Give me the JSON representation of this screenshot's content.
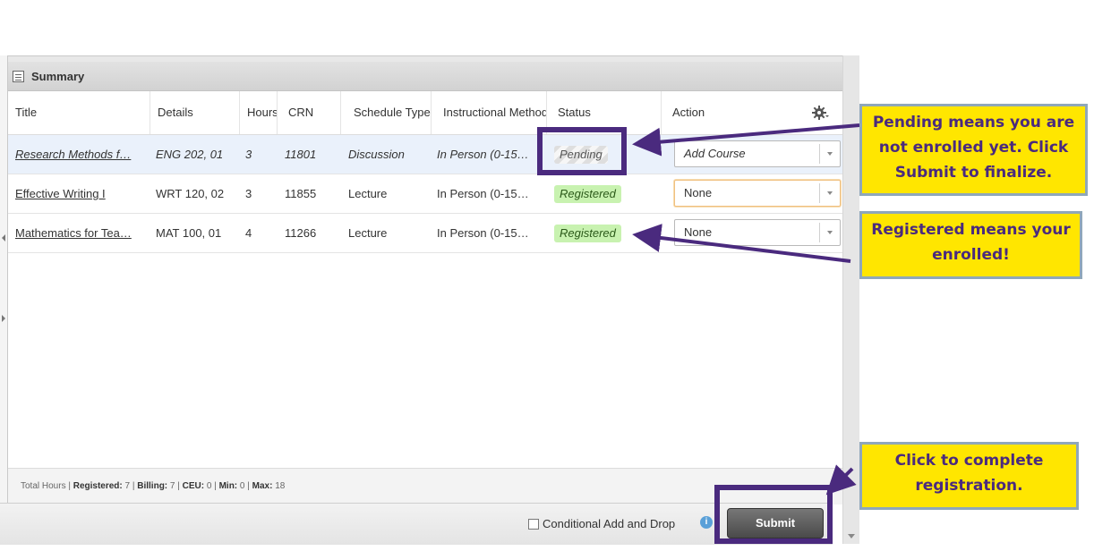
{
  "panel": {
    "title": "Summary"
  },
  "columns": [
    "Title",
    "Details",
    "Hours",
    "CRN",
    "Schedule Type",
    "Instructional Method",
    "Status",
    "Action"
  ],
  "rows": [
    {
      "title": "Research Methods f…",
      "details": "ENG 202, 01",
      "hours": "3",
      "crn": "11801",
      "schedule": "Discussion",
      "method": "In Person (0-15…",
      "status": "Pending",
      "action": "Add Course"
    },
    {
      "title": "Effective Writing I",
      "details": "WRT 120, 02",
      "hours": "3",
      "crn": "11855",
      "schedule": "Lecture",
      "method": "In Person (0-15…",
      "status": "Registered",
      "action": "None"
    },
    {
      "title": "Mathematics for Tea…",
      "details": "MAT 100, 01",
      "hours": "4",
      "crn": "11266",
      "schedule": "Lecture",
      "method": "In Person (0-15…",
      "status": "Registered",
      "action": "None"
    }
  ],
  "totals": {
    "label": "Total Hours",
    "registered_label": "Registered:",
    "registered": "7",
    "billing_label": "Billing:",
    "billing": "7",
    "ceu_label": "CEU:",
    "ceu": "0",
    "min_label": "Min:",
    "min": "0",
    "max_label": "Max:",
    "max": "18"
  },
  "footer": {
    "conditional_label": "Conditional Add and Drop",
    "submit_label": "Submit"
  },
  "callouts": {
    "pending": [
      "Pending means you are",
      "not enrolled yet.  Click",
      "Submit to finalize."
    ],
    "registered": [
      "Registered means your",
      "enrolled!"
    ],
    "submit": [
      "Click to complete",
      "registration."
    ]
  },
  "colors": {
    "highlight": "#4a2a7e",
    "callout_bg": "#ffe600",
    "registered_bg": "#c8f2b0"
  },
  "icons": {
    "gear": "gear-icon",
    "info": "info-icon",
    "summary": "summary-icon"
  }
}
